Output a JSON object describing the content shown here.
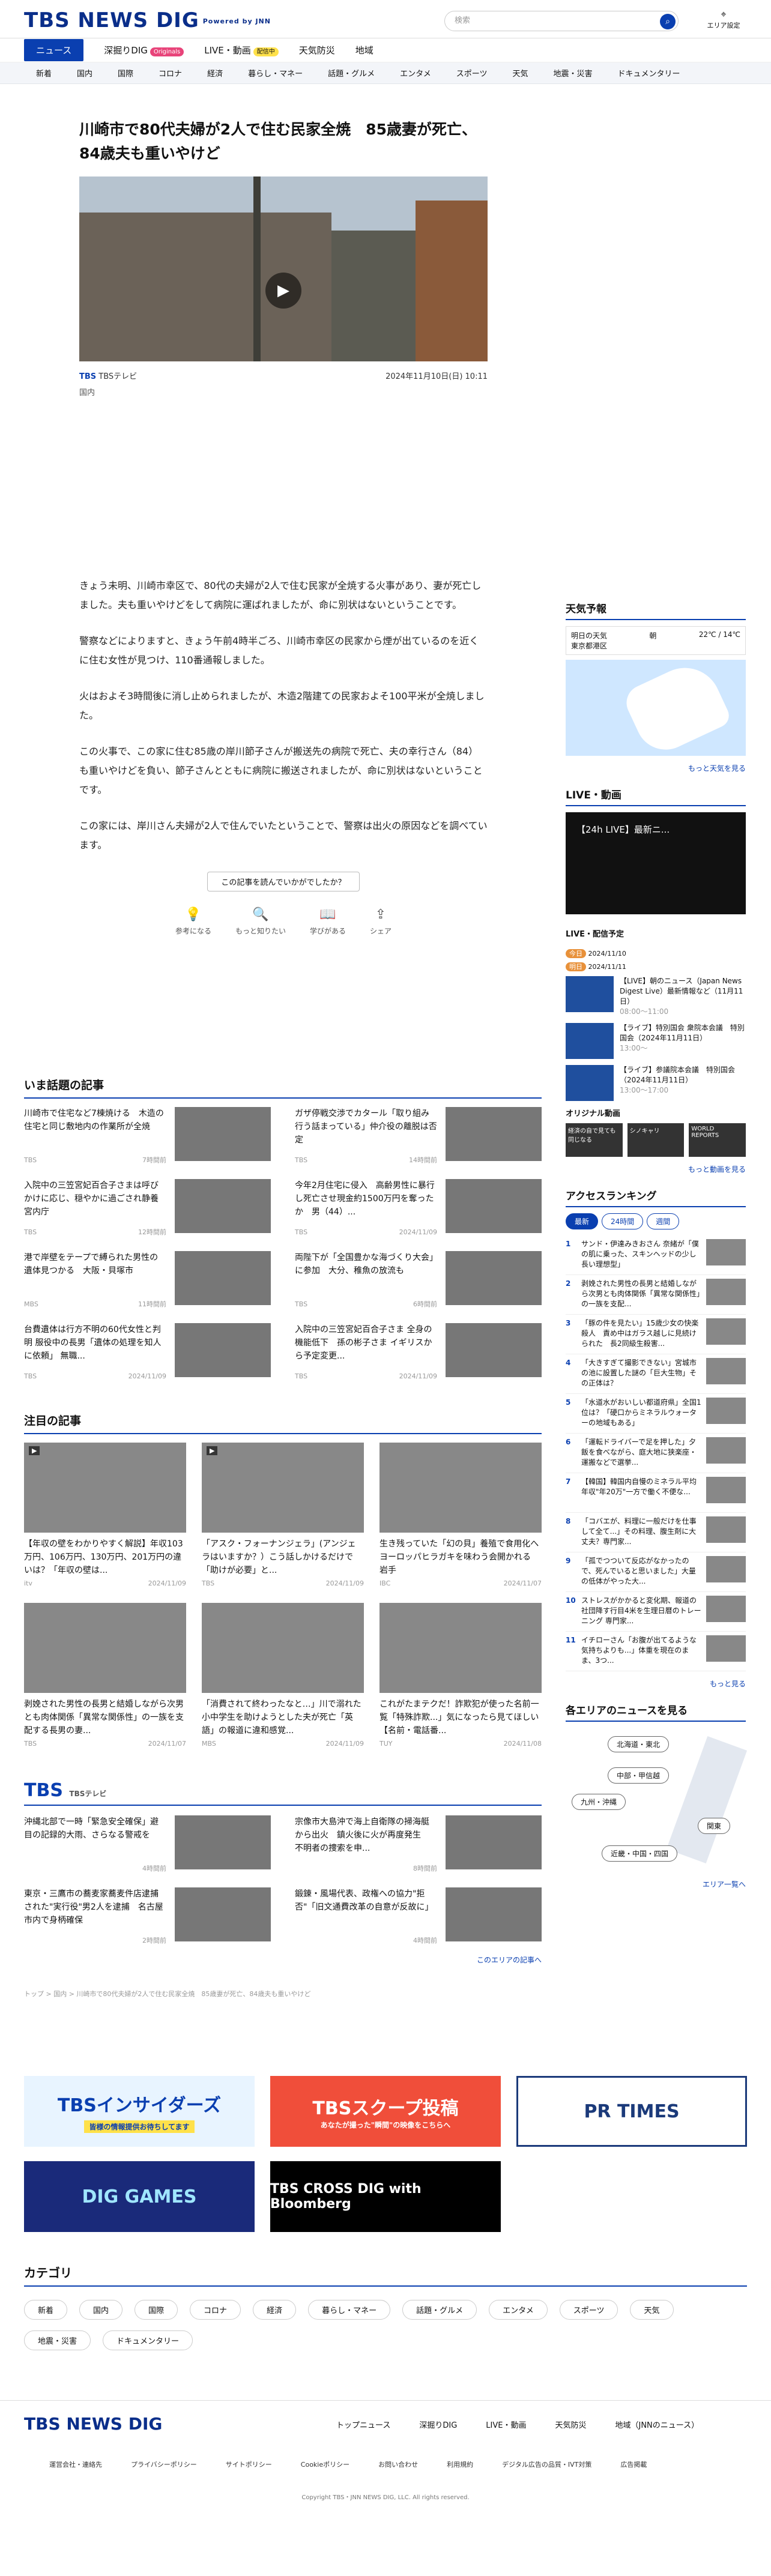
{
  "header": {
    "logo": "TBS NEWS DIG",
    "powered": "Powered by JNN",
    "search_placeholder": "検索",
    "area_label": "エリア設定"
  },
  "gnav": [
    "ニュース",
    "深掘りDIG",
    "LIVE・動画",
    "天気防災",
    "地域"
  ],
  "gnav_badges": {
    "originals": "Originals",
    "live": "配信中"
  },
  "snav": [
    "新着",
    "国内",
    "国際",
    "コロナ",
    "経済",
    "暮らし・マネー",
    "話題・グルメ",
    "エンタメ",
    "スポーツ",
    "天気",
    "地震・災害",
    "ドキュメンタリー"
  ],
  "article": {
    "title": "川崎市で80代夫婦が2人で住む民家全焼　85歳妻が死亡、84歳夫も重いやけど",
    "source": "TBS",
    "source_name": "TBSテレビ",
    "date": "2024年11月10日(日) 10:11",
    "category": "国内",
    "paragraphs": [
      "きょう未明、川崎市幸区で、80代の夫婦が2人で住む民家が全焼する火事があり、妻が死亡しました。夫も重いやけどをして病院に運ばれましたが、命に別状はないということです。",
      "警察などによりますと、きょう午前4時半ごろ、川崎市幸区の民家から煙が出ているのを近くに住む女性が見つけ、110番通報しました。",
      "火はおよそ3時間後に消し止められましたが、木造2階建ての民家およそ100平米が全焼しました。",
      "この火事で、この家に住む85歳の岸川節子さんが搬送先の病院で死亡、夫の幸行さん（84）も重いやけどを負い、節子さんとともに病院に搬送されましたが、命に別状はないということです。",
      "この家には、岸川さん夫婦が2人で住んでいたということで、警察は出火の原因などを調べています。"
    ],
    "feedback": "この記事を読んでいかがでしたか？",
    "reactions": [
      "参考になる",
      "もっと知りたい",
      "学びがある",
      "シェア"
    ]
  },
  "trending": {
    "title": "いま話題の記事",
    "items": [
      {
        "t": "川崎市で住宅など7棟焼ける　木造の住宅と同じ敷地内の作業所が全焼",
        "s": "TBS",
        "d": "7時間前"
      },
      {
        "t": "ガザ停戦交渉でカタール「取り組み行う話まっている」仲介役の離脱は否定",
        "s": "TBS",
        "d": "14時間前"
      },
      {
        "t": "入院中の三笠宮妃百合子さまは呼びかけに応じ、穏やかに過ごされ静養　宮内庁",
        "s": "TBS",
        "d": "12時間前"
      },
      {
        "t": "今年2月住宅に侵入　高齢男性に暴行し死亡させ現金約1500万円を奪ったか　男（44）...",
        "s": "TBS",
        "d": "2024/11/09"
      },
      {
        "t": "港で岸壁をテープで縛られた男性の遺体見つかる　大阪・貝塚市",
        "s": "MBS",
        "d": "11時間前"
      },
      {
        "t": "両陛下が「全国豊かな海づくり大会」に参加　大分、稚魚の放流も",
        "s": "TBS",
        "d": "6時間前"
      },
      {
        "t": "台費遺体は行方不明の60代女性と判明 服役中の長男「遺体の処理を知人に依頼」 無職...",
        "s": "TBS",
        "d": "2024/11/09"
      },
      {
        "t": "入院中の三笠宮妃百合子さま 全身の機能低下　孫の彬子さま イギリスから予定変更...",
        "s": "TBS",
        "d": "2024/11/09"
      }
    ]
  },
  "featured": {
    "title": "注目の記事",
    "items": [
      {
        "t": "【年収の壁をわかりやすく解説】年収103万円、106万円、130万円、201万円の違いは？「年収の壁は...",
        "s": "itv",
        "d": "2024/11/09"
      },
      {
        "t": "「アスク・フォーナンジェラ」(アンジェラはいますか？）こう話しかけるだけで「助けが必要」と...",
        "s": "TBS",
        "d": "2024/11/09"
      },
      {
        "t": "生き残っていた「幻の貝」養殖で食用化へ　ヨーロッパヒラガキを味わう会開かれる　岩手",
        "s": "IBC",
        "d": "2024/11/07"
      },
      {
        "t": "剥娩された男性の長男と結婚しながら次男とも肉体関係「異常な関係性」の一族を支配する長男の妻...",
        "s": "TBS",
        "d": "2024/11/07"
      },
      {
        "t": "「消費されて終わったなと…」川で溺れた小中学生を助けようとした夫が死亡「英語」の報道に違和感覚...",
        "s": "MBS",
        "d": "2024/11/09"
      },
      {
        "t": "これがたまテクだ！詐欺犯が使った名前一覧「特殊詐欺...」気になったら見てほしい【名前・電話番...",
        "s": "TUY",
        "d": "2024/11/08"
      }
    ]
  },
  "tbs_block": {
    "title": "TBS",
    "sub": "TBSテレビ",
    "items": [
      {
        "t": "沖縄北部で一時「緊急安全確保」避目の記録的大雨、さらなる警戒を",
        "d": "4時間前"
      },
      {
        "t": "宗像市大島沖で海上自衛隊の掃海艇から出火　鎮火後に火が再度発生　不明者の捜索を申...",
        "d": "8時間前"
      },
      {
        "t": "東京・三鷹市の蕎麦家蕎麦件店逮捕された\"実行役\"男2人を逮捕　名古屋市内で身柄確保",
        "d": "2時間前"
      },
      {
        "t": "鍛錬・風場代表、政権への協力\"拒否\"「旧文通費改革の自意が反故に」",
        "d": "4時間前"
      }
    ],
    "more": "このエリアの記事へ"
  },
  "breadcrumb": "トップ > 国内 > 川崎市で80代夫婦が2人で住む民家全焼　85歳妻が死亡、84歳夫も重いやけど",
  "banners": [
    "TBSインサイダーズ",
    "TBSスクープ投稿",
    "PR TIMES",
    "DIG GAMES",
    "TBS CROSS DIG with Bloomberg"
  ],
  "banner_subs": {
    "insiders": "皆様の情報提供お待ちしてます",
    "scoop": "あなたが撮った\"瞬間\"の映像をこちらへ"
  },
  "categories": {
    "title": "カテゴリ",
    "items": [
      "新着",
      "国内",
      "国際",
      "コロナ",
      "経済",
      "暮らし・マネー",
      "話題・グルメ",
      "エンタメ",
      "スポーツ",
      "天気",
      "地震・災害",
      "ドキュメンタリー"
    ]
  },
  "sidebar": {
    "weather": {
      "title": "天気予報",
      "day": "明日の天気",
      "city": "東京都港区",
      "icon": "朝",
      "temp": "22℃ / 14℃",
      "more": "もっと天気を見る"
    },
    "live": {
      "title": "LIVE・動画",
      "video_title": "【24h LIVE】最新ニ..."
    },
    "schedule": {
      "title": "LIVE・配信予定",
      "d1": "2024/11/10",
      "d2": "2024/11/11",
      "items": [
        {
          "t": "【LIVE】朝のニュース（Japan News Digest Live）最新情報など（11月11日）",
          "tm": "08:00〜11:00"
        },
        {
          "t": "【ライブ】特別国会 衆院本会議　特別国会（2024年11月11日）",
          "tm": "13:00〜"
        },
        {
          "t": "【ライブ】参議院本会議　特別国会（2024年11月11日）",
          "tm": "13:00〜17:00"
        }
      ]
    },
    "original": {
      "title": "オリジナル動画",
      "items": [
        "経済の自で見ても同じなる",
        "シノキャリ",
        "WORLD REPORTS"
      ],
      "more": "もっと動画を見る"
    },
    "ranking": {
      "title": "アクセスランキング",
      "tabs": [
        "最新",
        "24時間",
        "週間"
      ],
      "items": [
        "サンド・伊達みきおさん 奈緒が「僕の肌に乗った、スキンヘッドの少し長い理想型」",
        "剥娩された男性の長男と結婚しながら次男とも肉体関係「異常な関係性」の一族を支配...",
        "「豚の件を見たい」15歳少女の快楽殺人　責め中はガラス越しに見続けられた　長2同級生殺害...",
        "「大きすぎて撮影できない」宮城市の池に設置した謎の「巨大生物」その正体は？",
        "「水道水がおいしい都道府県」全国1位は？「硬口からミネラルウォーターの地域もある」",
        "「運転ドライバーで足を押した」夕飯を食べながら、庭大地に狭楽座・運搬などで選挙...",
        "【韓国】韓国内自慢のミネラル平均年収\"年20万\"一方で働く不便な...",
        "「コバエが、料理に一般だけを仕事して全て...」その料理、腹生剤に大丈夫？専門家...",
        "「孤でつついて反応がなかったので、死んでいると思いました」大量の低体がやった大...",
        "ストレスがかかると変化期、報道の社団降す行目4米を生理日暦のトレーニング 専門家...",
        "イチローさん「お腹が出てるような気持ちよりも...」体重を現在のまま、3つ..."
      ],
      "more": "もっと見る"
    },
    "areas": {
      "title": "各エリアのニュースを見る",
      "items": [
        "北海道・東北",
        "中部・甲信越",
        "九州・沖縄",
        "関東",
        "近畿・中国・四国"
      ],
      "more": "エリア一覧へ"
    }
  },
  "footer": {
    "nav": [
      "トップニュース",
      "深掘りDIG",
      "LIVE・動画",
      "天気防災",
      "地域（JNNのニュース）"
    ],
    "links": [
      "運営会社・連絡先",
      "プライバシーポリシー",
      "サイトポリシー",
      "Cookieポリシー",
      "お問い合わせ",
      "利用規約",
      "デジタル広告の品質・IVT対策",
      "広告掲載"
    ],
    "copyright": "Copyright TBS・JNN NEWS DIG, LLC. All rights reserved."
  }
}
